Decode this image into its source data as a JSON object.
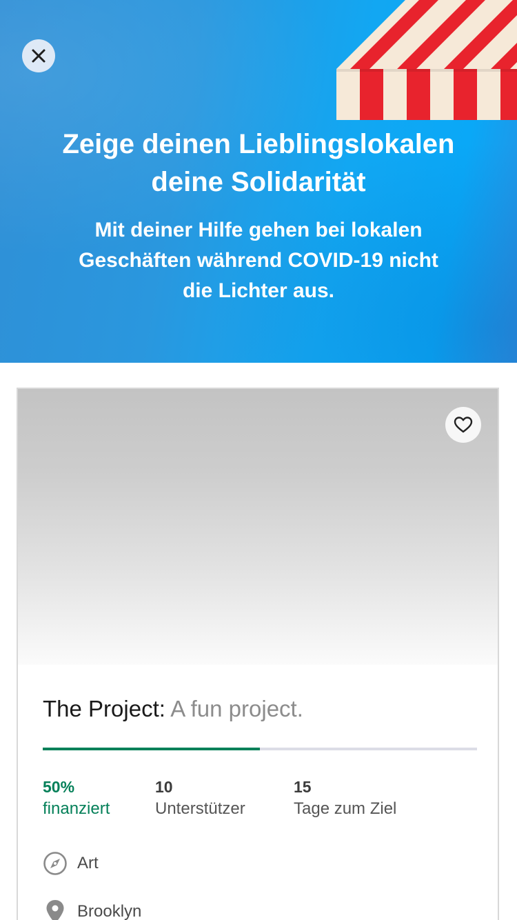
{
  "hero": {
    "title_line1": "Zeige deinen Lieblingslokalen",
    "title_line2": "deine Solidarität",
    "subtitle_line1": "Mit deiner Hilfe gehen bei lokalen",
    "subtitle_line2": "Geschäften während COVID-19 nicht",
    "subtitle_line3": "die Lichter aus.",
    "close_icon": "close-icon",
    "awning_colors": [
      "#e8232d",
      "#f6e9d8"
    ]
  },
  "project": {
    "name": "The Project:",
    "blurb": " A fun project.",
    "favorite_icon": "heart-outline-icon",
    "funded_fraction": 0.5,
    "stats": {
      "funded_value": "50%",
      "funded_label": "finanziert",
      "backers_value": "10",
      "backers_label": "Unterstützer",
      "days_value": "15",
      "days_label": "Tage zum Ziel"
    },
    "category": "Art",
    "category_icon": "compass-icon",
    "location": "Brooklyn",
    "location_icon": "location-pin-icon"
  },
  "colors": {
    "accent_green": "#058059",
    "track_gray": "#dcdde6"
  }
}
